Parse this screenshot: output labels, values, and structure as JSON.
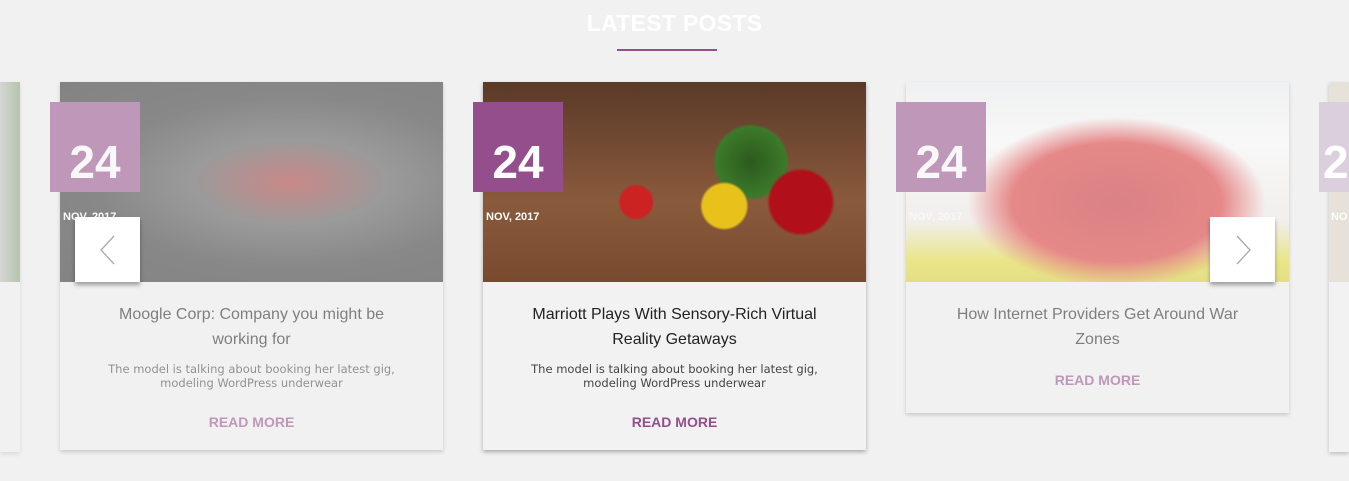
{
  "section": {
    "title": "LATEST POSTS",
    "accent": "#954e8c"
  },
  "posts": [
    {
      "day": "24",
      "month": "NOV, 2017",
      "title": "Moogle Corp: Company you might be working for",
      "excerpt": "The model is talking about booking her latest gig, modeling WordPress underwear",
      "read_more": "READ MORE",
      "image": "berries"
    },
    {
      "day": "24",
      "month": "NOV, 2017",
      "title": "Marriott Plays With Sensory-Rich Virtual Reality Getaways",
      "excerpt": "The model is talking about booking her latest gig, modeling WordPress underwear",
      "read_more": "READ MORE",
      "image": "vegetables"
    },
    {
      "day": "24",
      "month": "NOV, 2017",
      "title": "How Internet Providers Get Around War Zones",
      "read_more": "READ MORE",
      "image": "strawberries"
    }
  ],
  "partial_right": {
    "day": "2",
    "month": "NO"
  },
  "nav": {
    "prev": "prev-arrow",
    "next": "next-arrow"
  }
}
